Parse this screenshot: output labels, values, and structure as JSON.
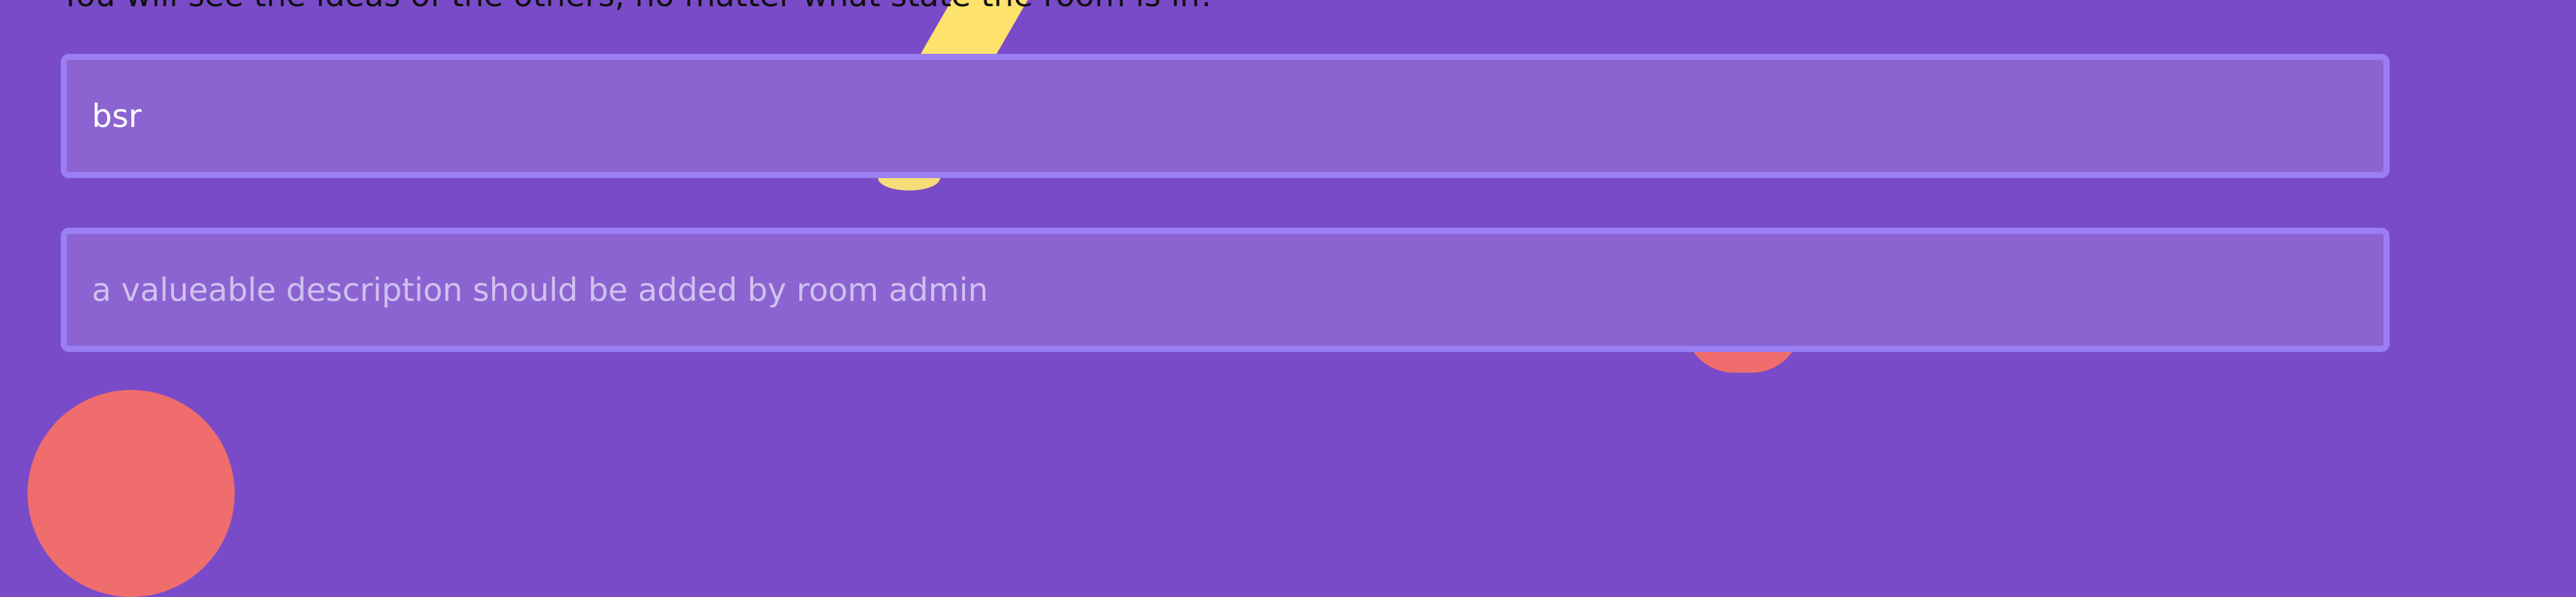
{
  "intro": {
    "text": "You will see the ideas of the others, no matter what state the room is in!"
  },
  "room_form": {
    "title_value": "bsr",
    "description_placeholder": "a valueable description should be added by room admin"
  },
  "colors": {
    "background": "#7a4bc9",
    "field_background": "#8b64d1",
    "field_border": "#9a7ef2",
    "decor_yellow": "#fde36b",
    "decor_coral": "#ef6d6d"
  }
}
